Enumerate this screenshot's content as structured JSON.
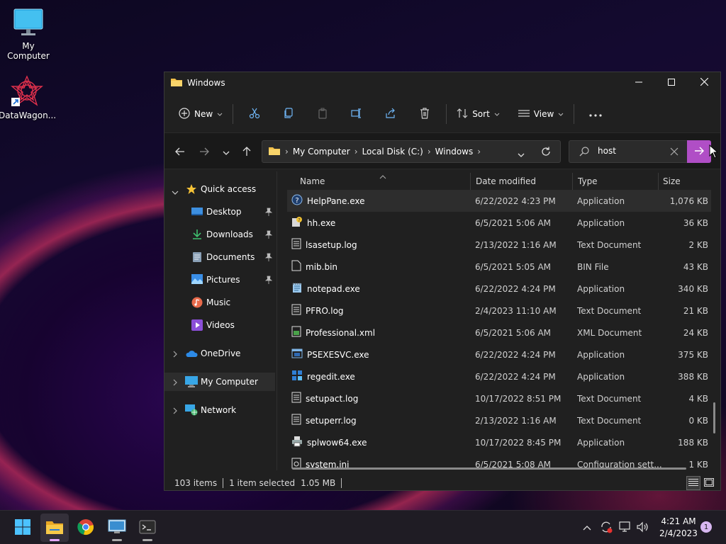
{
  "desktop": {
    "icons": [
      {
        "label": "My Computer",
        "icon": "monitor-icon"
      },
      {
        "label": "DataWagon...",
        "icon": "datawagon-logo-icon"
      }
    ]
  },
  "window": {
    "title": "Windows",
    "controls": {
      "minimize": "minimize-icon",
      "maximize": "maximize-icon",
      "close": "close-icon"
    }
  },
  "toolbar": {
    "new_label": "New",
    "sort_label": "Sort",
    "view_label": "View",
    "icons": [
      "cut-icon",
      "copy-icon",
      "paste-icon",
      "rename-icon",
      "share-icon",
      "delete-icon",
      "more-icon"
    ]
  },
  "address": {
    "crumbs": [
      "My Computer",
      "Local Disk (C:)",
      "Windows"
    ]
  },
  "search": {
    "value": "host"
  },
  "nav": {
    "quick_access": "Quick access",
    "items": [
      {
        "label": "Desktop",
        "pinned": true
      },
      {
        "label": "Downloads",
        "pinned": true
      },
      {
        "label": "Documents",
        "pinned": true
      },
      {
        "label": "Pictures",
        "pinned": true
      },
      {
        "label": "Music",
        "pinned": false
      },
      {
        "label": "Videos",
        "pinned": false
      }
    ],
    "onedrive": "OneDrive",
    "my_computer": "My Computer",
    "network": "Network"
  },
  "columns": {
    "name": "Name",
    "date": "Date modified",
    "type": "Type",
    "size": "Size"
  },
  "files": [
    {
      "name": "HelpPane.exe",
      "date": "6/22/2022 4:23 PM",
      "type": "Application",
      "size": "1,076 KB"
    },
    {
      "name": "hh.exe",
      "date": "6/5/2021 5:06 AM",
      "type": "Application",
      "size": "36 KB"
    },
    {
      "name": "lsasetup.log",
      "date": "2/13/2022 1:16 AM",
      "type": "Text Document",
      "size": "2 KB"
    },
    {
      "name": "mib.bin",
      "date": "6/5/2021 5:05 AM",
      "type": "BIN File",
      "size": "43 KB"
    },
    {
      "name": "notepad.exe",
      "date": "6/22/2022 4:24 PM",
      "type": "Application",
      "size": "340 KB"
    },
    {
      "name": "PFRO.log",
      "date": "2/4/2023 11:10 AM",
      "type": "Text Document",
      "size": "21 KB"
    },
    {
      "name": "Professional.xml",
      "date": "6/5/2021 5:06 AM",
      "type": "XML Document",
      "size": "24 KB"
    },
    {
      "name": "PSEXESVC.exe",
      "date": "6/22/2022 4:24 PM",
      "type": "Application",
      "size": "375 KB"
    },
    {
      "name": "regedit.exe",
      "date": "6/22/2022 4:24 PM",
      "type": "Application",
      "size": "388 KB"
    },
    {
      "name": "setupact.log",
      "date": "10/17/2022 8:51 PM",
      "type": "Text Document",
      "size": "4 KB"
    },
    {
      "name": "setuperr.log",
      "date": "2/13/2022 1:16 AM",
      "type": "Text Document",
      "size": "0 KB"
    },
    {
      "name": "splwow64.exe",
      "date": "10/17/2022 8:45 PM",
      "type": "Application",
      "size": "188 KB"
    },
    {
      "name": "system.ini",
      "date": "6/5/2021 5:08 AM",
      "type": "Configuration sett...",
      "size": "1 KB"
    }
  ],
  "status": {
    "count": "103 items",
    "selected": "1 item selected",
    "size": "1.05 MB"
  },
  "taskbar": {
    "apps": [
      "start-icon",
      "file-explorer-icon",
      "chrome-icon",
      "remote-desktop-icon",
      "terminal-icon"
    ],
    "time": "4:21 AM",
    "date": "2/4/2023",
    "notifications": "1"
  },
  "colors": {
    "accent": "#b04ec6",
    "window_bg": "#202020",
    "folder": "#f3c14a"
  }
}
